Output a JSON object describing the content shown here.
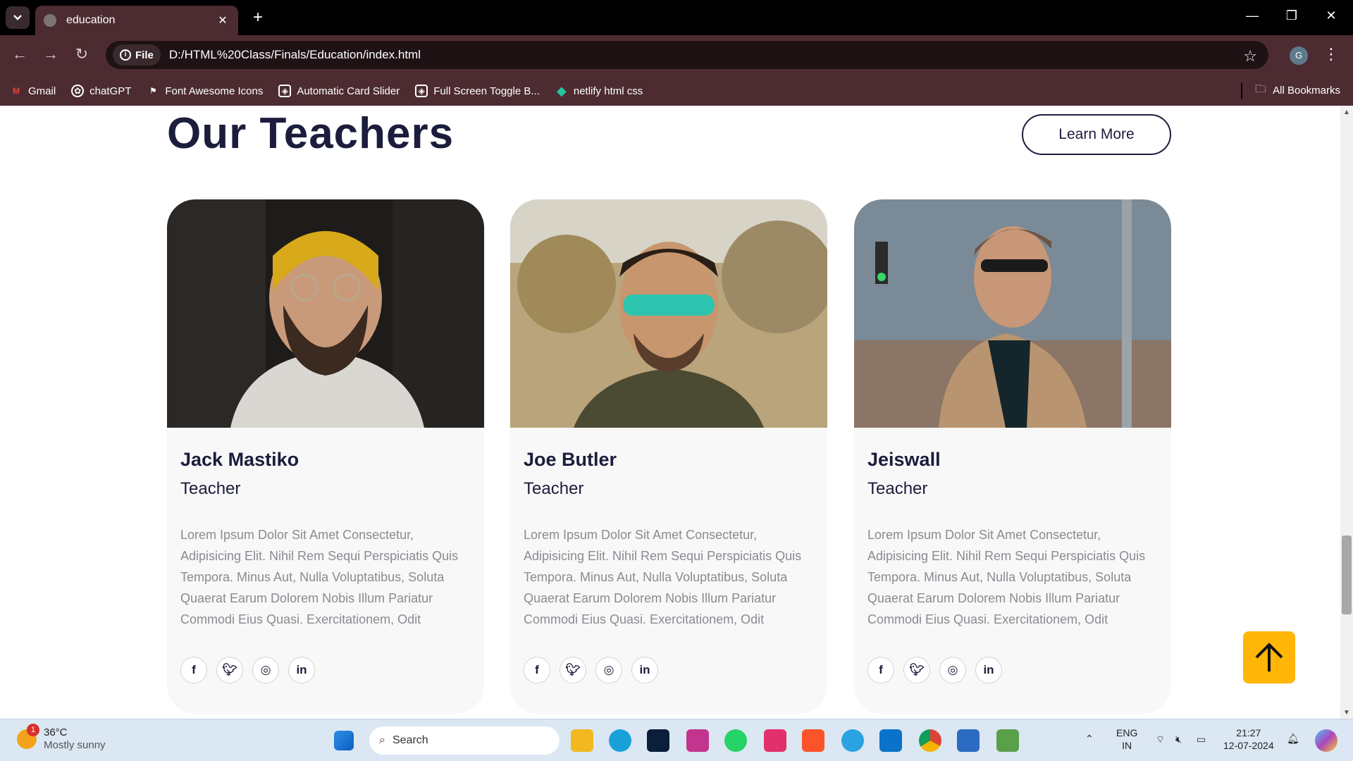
{
  "browser": {
    "tab_title": "education",
    "new_tab": "+",
    "file_label": "File",
    "url": "D:/HTML%20Class/Finals/Education/index.html",
    "profile_initial": "G",
    "bookmarks": [
      "Gmail",
      "chatGPT",
      "Font Awesome Icons",
      "Automatic Card Slider",
      "Full Screen Toggle B...",
      "netlify html css"
    ],
    "all_bookmarks": "All Bookmarks"
  },
  "section": {
    "title": "Our Teachers",
    "learn_more": "Learn More"
  },
  "teachers": [
    {
      "name": "Jack Mastiko",
      "role": "Teacher",
      "desc": "Lorem Ipsum Dolor Sit Amet Consectetur, Adipisicing Elit. Nihil Rem Sequi Perspiciatis Quis Tempora. Minus Aut, Nulla Voluptatibus, Soluta Quaerat Earum Dolorem Nobis Illum Pariatur Commodi Eius Quasi. Exercitationem, Odit"
    },
    {
      "name": "Joe Butler",
      "role": "Teacher",
      "desc": "Lorem Ipsum Dolor Sit Amet Consectetur, Adipisicing Elit. Nihil Rem Sequi Perspiciatis Quis Tempora. Minus Aut, Nulla Voluptatibus, Soluta Quaerat Earum Dolorem Nobis Illum Pariatur Commodi Eius Quasi. Exercitationem, Odit"
    },
    {
      "name": "Jeiswall",
      "role": "Teacher",
      "desc": "Lorem Ipsum Dolor Sit Amet Consectetur, Adipisicing Elit. Nihil Rem Sequi Perspiciatis Quis Tempora. Minus Aut, Nulla Voluptatibus, Soluta Quaerat Earum Dolorem Nobis Illum Pariatur Commodi Eius Quasi. Exercitationem, Odit"
    }
  ],
  "social_icons": [
    "f",
    "twitter",
    "instagram",
    "in"
  ],
  "colors": {
    "accent": "#ffb606",
    "heading": "#1c1d3c",
    "browser": "#4c2c31"
  },
  "taskbar": {
    "temp": "36°C",
    "weather": "Mostly sunny",
    "badge": "1",
    "search": "Search",
    "lang1": "ENG",
    "lang2": "IN",
    "time": "21:27",
    "date": "12-07-2024"
  }
}
